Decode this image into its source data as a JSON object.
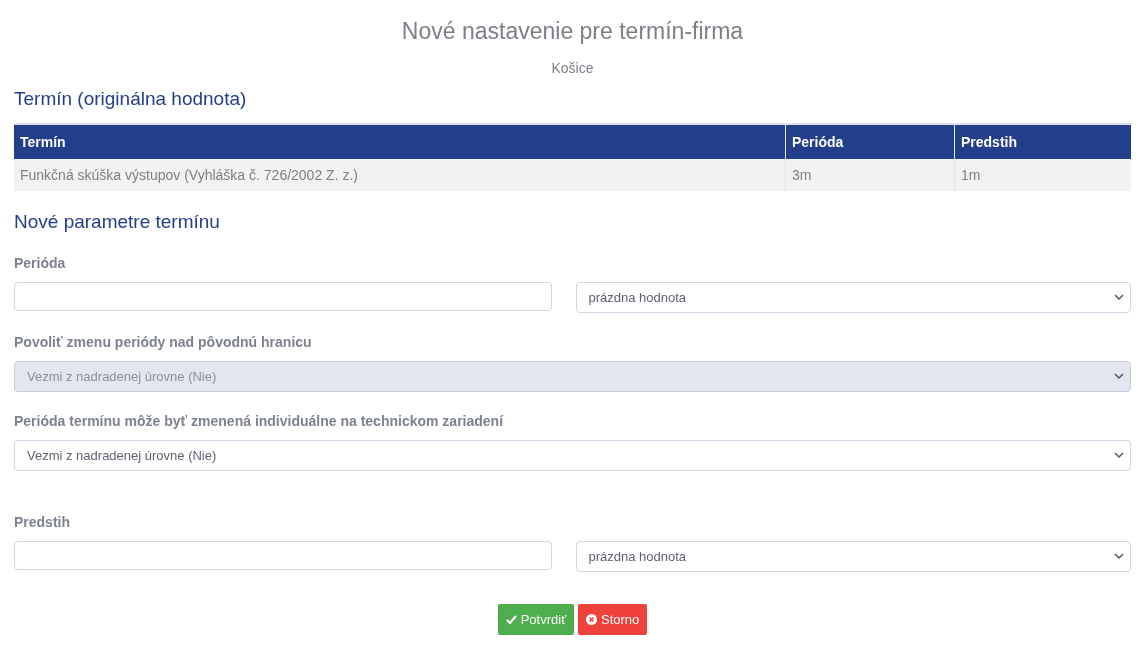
{
  "page": {
    "title": "Nové nastavenie pre termín-firma",
    "subtitle": "Košice"
  },
  "original": {
    "heading": "Termín (originálna hodnota)",
    "table": {
      "columns": [
        "Termín",
        "Perióda",
        "Predstih"
      ],
      "rows": [
        [
          "Funkčná skúška výstupov (Vyhláška č. 726/2002 Z. z.)",
          "3m",
          "1m"
        ]
      ]
    }
  },
  "form": {
    "heading": "Nové parametre termínu",
    "fields": [
      {
        "kind": "pair",
        "label": "Perióda",
        "select": "prázdna hodnota",
        "disabled": false
      },
      {
        "kind": "select",
        "label": "Povoliť zmenu periódy nad pôvodnú hranicu",
        "select": "Vezmi z nadradenej úrovne (Nie)",
        "disabled": true
      },
      {
        "kind": "select",
        "label": "Perióda termínu môže byť zmenená individuálne na technickom zariadení",
        "select": "Vezmi z nadradenej úrovne (Nie)",
        "disabled": false
      },
      {
        "kind": "pair",
        "label": "Predstih",
        "select": "prázdna hodnota",
        "disabled": false
      }
    ]
  },
  "buttons": [
    {
      "kind": "confirm",
      "label": "Potvrdiť"
    },
    {
      "kind": "cancel",
      "label": "Storno"
    }
  ]
}
